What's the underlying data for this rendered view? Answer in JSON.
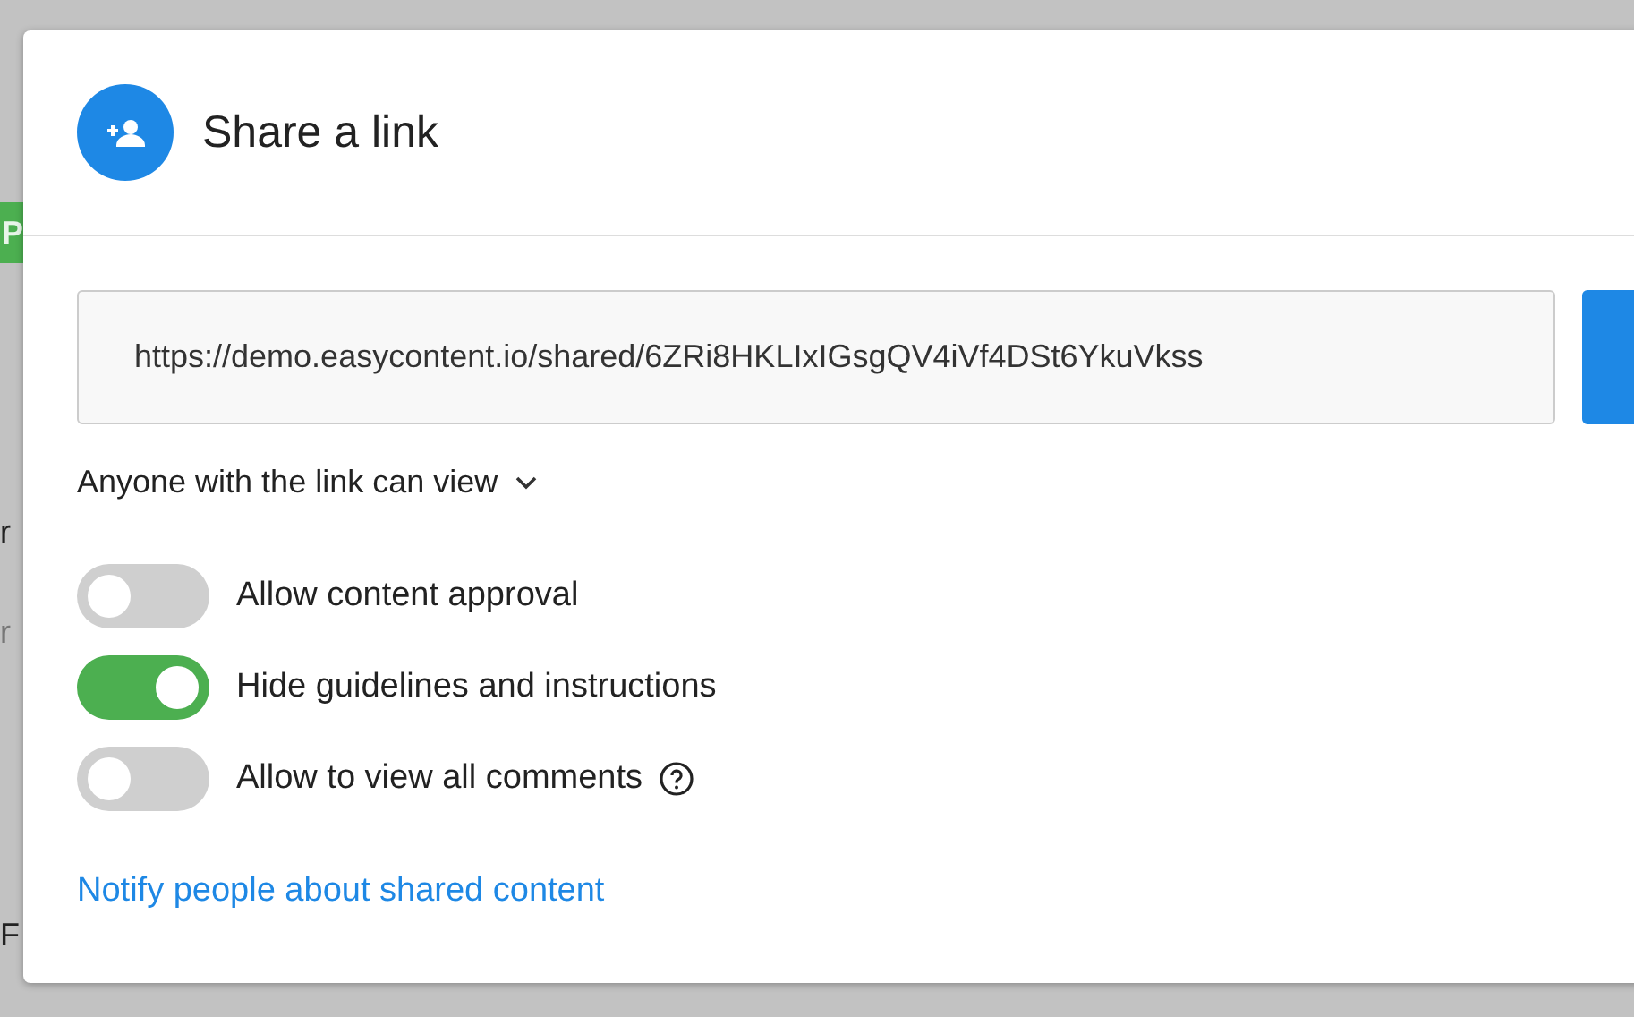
{
  "background": {
    "fragments": [
      {
        "text": "P",
        "kind": "button"
      },
      {
        "text": "r",
        "kind": "text"
      },
      {
        "text": "r",
        "kind": "muted"
      },
      {
        "text": "F",
        "kind": "text"
      }
    ]
  },
  "dialog": {
    "title": "Share a link",
    "link_field": {
      "value": "https://demo.easycontent.io/shared/6ZRi8HKLIxIGsgQV4iVf4DSt6YkuVkss"
    },
    "access_dropdown": {
      "label": "Anyone with the link can view"
    },
    "toggles": [
      {
        "label": "Allow content approval",
        "on": false,
        "help": false
      },
      {
        "label": "Hide guidelines and instructions",
        "on": true,
        "help": false
      },
      {
        "label": "Allow to view all comments",
        "on": false,
        "help": true
      }
    ],
    "notify_link": "Notify people about shared content"
  }
}
